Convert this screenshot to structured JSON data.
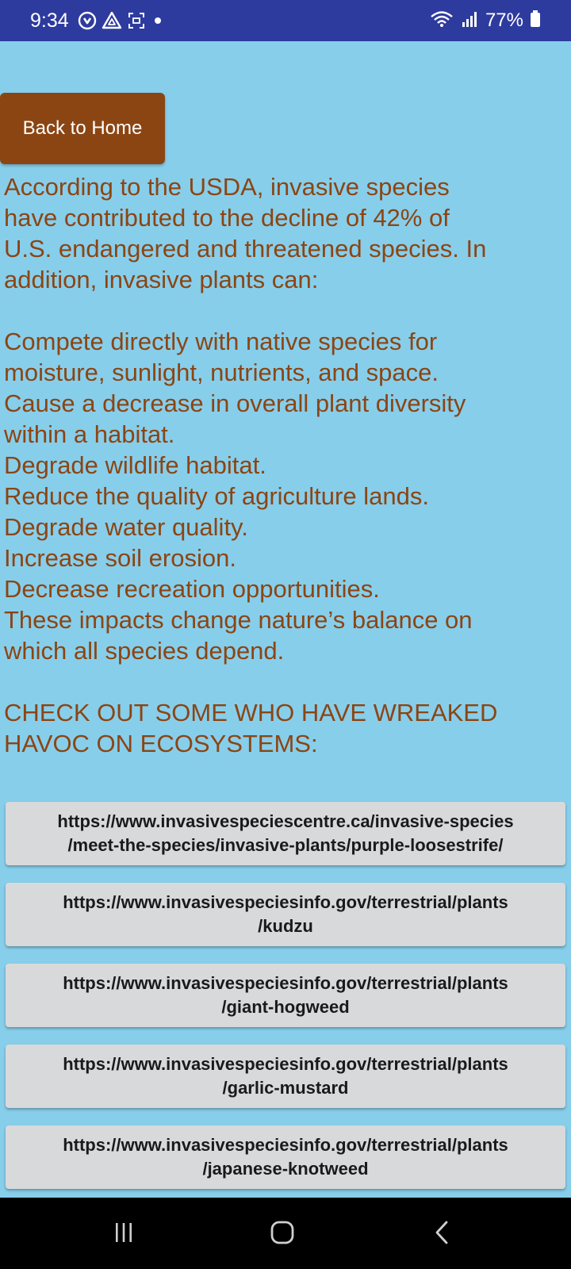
{
  "status_bar": {
    "time": "9:34",
    "battery": "77%",
    "icons": [
      "sync-icon",
      "drive-icon",
      "screenshot-icon",
      "dot-icon",
      "wifi-icon",
      "signal-icon",
      "battery-icon"
    ]
  },
  "back_button": {
    "label": "Back to Home"
  },
  "content": {
    "intro_lines": [
      "According to the USDA, invasive species",
      "have contributed to the decline of 42% of",
      "U.S. endangered and threatened species. In",
      "addition, invasive plants can:"
    ],
    "impact_lines": [
      "Compete directly with native species for",
      "moisture, sunlight, nutrients, and space.",
      "Cause a decrease in overall plant diversity",
      "within a habitat.",
      "Degrade wildlife habitat.",
      "Reduce the quality of agriculture lands.",
      "Degrade water quality.",
      "Increase soil erosion.",
      "Decrease recreation opportunities.",
      "These impacts change nature’s balance on",
      "which all species depend."
    ],
    "check_out_lines": [
      "CHECK OUT SOME WHO HAVE WREAKED",
      "HAVOC ON ECOSYSTEMS:"
    ]
  },
  "links": [
    {
      "line1": "https://www.invasivespeciescentre.ca/invasive-species",
      "line2": "/meet-the-species/invasive-plants/purple-loosestrife/"
    },
    {
      "line1": "https://www.invasivespeciesinfo.gov/terrestrial/plants",
      "line2": "/kudzu"
    },
    {
      "line1": "https://www.invasivespeciesinfo.gov/terrestrial/plants",
      "line2": "/giant-hogweed"
    },
    {
      "line1": "https://www.invasivespeciesinfo.gov/terrestrial/plants",
      "line2": "/garlic-mustard"
    },
    {
      "line1": "https://www.invasivespeciesinfo.gov/terrestrial/plants",
      "line2": "/japanese-knotweed"
    }
  ],
  "nav_bar": {
    "icons": [
      "recent-apps-icon",
      "home-icon",
      "back-icon"
    ]
  },
  "colors": {
    "status_bar_bg": "#2E3B9E",
    "page_bg": "#87CEEB",
    "accent_brown": "#8B4513",
    "link_button_bg": "#D8D9DA",
    "nav_bar_bg": "#000000"
  }
}
